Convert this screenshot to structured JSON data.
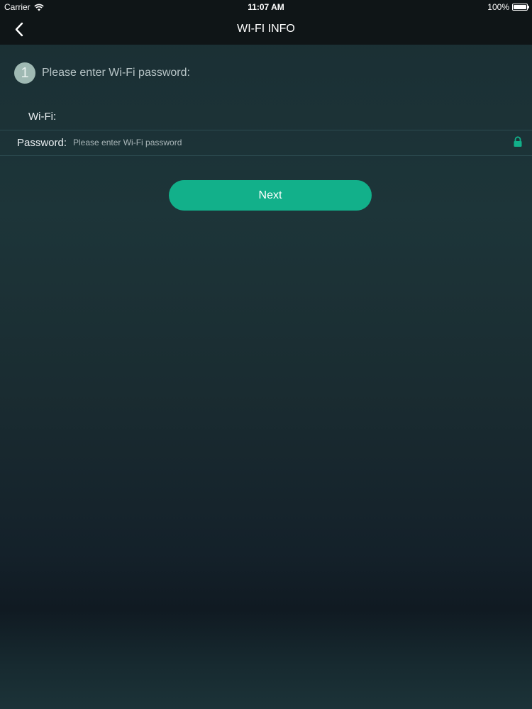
{
  "status_bar": {
    "carrier": "Carrier",
    "time": "11:07 AM",
    "battery": "100%"
  },
  "nav": {
    "title": "WI-FI INFO"
  },
  "step": {
    "number": "1",
    "text": "Please enter Wi-Fi password:"
  },
  "form": {
    "wifi_label": "Wi-Fi:",
    "wifi_value": "",
    "password_label": "Password:",
    "password_placeholder": "Please enter Wi-Fi password",
    "password_value": ""
  },
  "actions": {
    "next_label": "Next"
  },
  "colors": {
    "accent": "#12b08a",
    "nav_background": "#0f1517",
    "step_badge": "#9fb9b3"
  },
  "icons": {
    "back": "chevron-left-icon",
    "lock": "lock-icon",
    "wifi": "wifi-signal-icon",
    "battery": "battery-icon"
  }
}
